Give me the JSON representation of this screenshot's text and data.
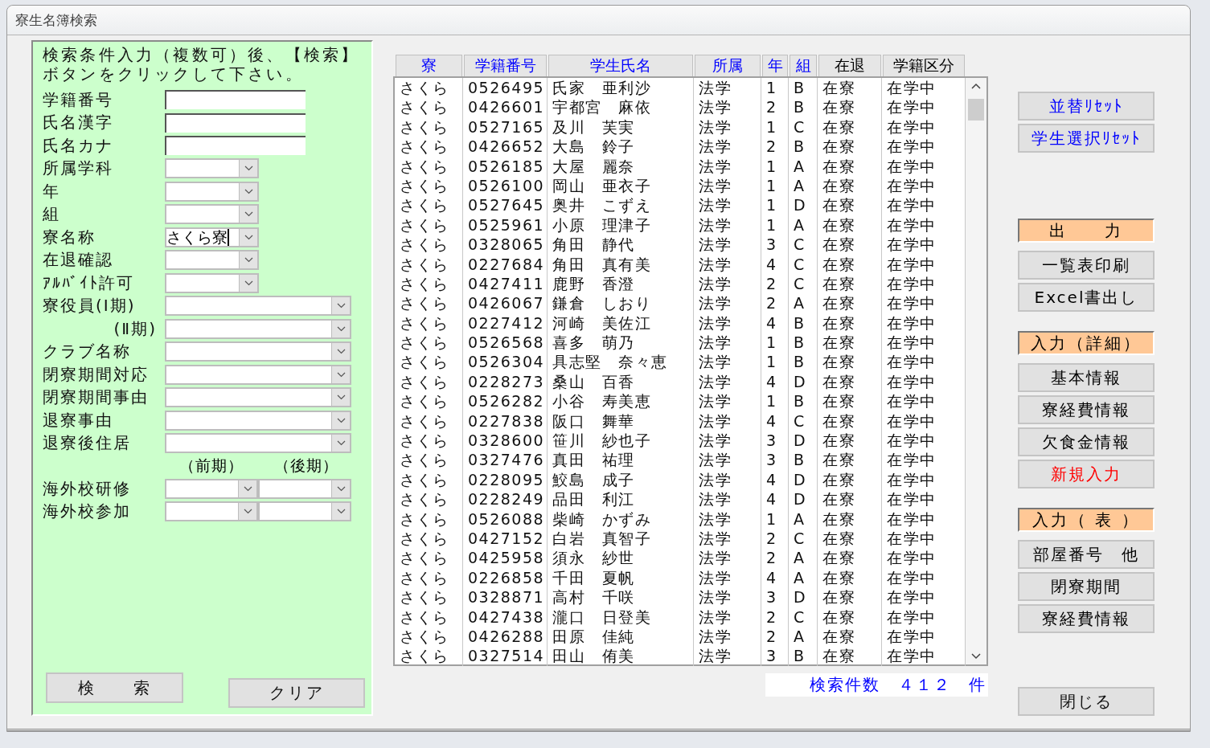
{
  "window": {
    "title": "寮生名簿検索"
  },
  "search_panel": {
    "instruction": "検索条件入力（複数可）後、【検索】ボタンをクリックして下さい。",
    "fields": [
      {
        "kind": "text",
        "label": "学籍番号"
      },
      {
        "kind": "text",
        "label": "氏名漢字"
      },
      {
        "kind": "text",
        "label": "氏名カナ"
      },
      {
        "kind": "select-short",
        "label": "所属学科"
      },
      {
        "kind": "select-short",
        "label": "年"
      },
      {
        "kind": "select-short",
        "label": "組"
      },
      {
        "kind": "select-short",
        "label": "寮名称",
        "value": "さくら寮"
      },
      {
        "kind": "select-short",
        "label": "在退確認"
      },
      {
        "kind": "select-short",
        "label": "ｱﾙﾊﾞｲﾄ許可"
      },
      {
        "kind": "select-long",
        "label": "寮役員(Ⅰ期)"
      },
      {
        "kind": "select-long",
        "label": "(Ⅱ期)",
        "indent": true
      },
      {
        "kind": "select-long",
        "label": "クラブ名称"
      },
      {
        "kind": "select-long",
        "label": "閉寮期間対応"
      },
      {
        "kind": "select-long",
        "label": "閉寮期間事由"
      },
      {
        "kind": "select-long",
        "label": "退寮事由"
      },
      {
        "kind": "select-long",
        "label": "退寮後住居"
      },
      {
        "kind": "captions",
        "captions": [
          "（前期）",
          "（後期）"
        ]
      },
      {
        "kind": "select-pair",
        "label": "海外校研修"
      },
      {
        "kind": "select-pair",
        "label": "海外校参加"
      }
    ],
    "buttons": [
      "検　　索",
      "クリア"
    ]
  },
  "table": {
    "columns": [
      {
        "label": "寮",
        "sortable": true
      },
      {
        "label": "学籍番号",
        "sortable": true
      },
      {
        "label": "学生氏名",
        "sortable": true
      },
      {
        "label": "所属",
        "sortable": true
      },
      {
        "label": "年",
        "sortable": true
      },
      {
        "label": "組",
        "sortable": true
      },
      {
        "label": "在退",
        "sortable": false
      },
      {
        "label": "学籍区分",
        "sortable": false
      }
    ],
    "rows": [
      [
        "さくら",
        "0526495",
        "氏家　亜利沙",
        "法学",
        "1",
        "B",
        "在寮",
        "在学中"
      ],
      [
        "さくら",
        "0426601",
        "宇都宮　麻依",
        "法学",
        "2",
        "B",
        "在寮",
        "在学中"
      ],
      [
        "さくら",
        "0527165",
        "及川　芙実",
        "法学",
        "1",
        "C",
        "在寮",
        "在学中"
      ],
      [
        "さくら",
        "0426652",
        "大島　鈴子",
        "法学",
        "2",
        "B",
        "在寮",
        "在学中"
      ],
      [
        "さくら",
        "0526185",
        "大屋　麗奈",
        "法学",
        "1",
        "A",
        "在寮",
        "在学中"
      ],
      [
        "さくら",
        "0526100",
        "岡山　亜衣子",
        "法学",
        "1",
        "A",
        "在寮",
        "在学中"
      ],
      [
        "さくら",
        "0527645",
        "奥井　こずえ",
        "法学",
        "1",
        "D",
        "在寮",
        "在学中"
      ],
      [
        "さくら",
        "0525961",
        "小原　理津子",
        "法学",
        "1",
        "A",
        "在寮",
        "在学中"
      ],
      [
        "さくら",
        "0328065",
        "角田　静代",
        "法学",
        "3",
        "C",
        "在寮",
        "在学中"
      ],
      [
        "さくら",
        "0227684",
        "角田　真有美",
        "法学",
        "4",
        "C",
        "在寮",
        "在学中"
      ],
      [
        "さくら",
        "0427411",
        "鹿野　香澄",
        "法学",
        "2",
        "C",
        "在寮",
        "在学中"
      ],
      [
        "さくら",
        "0426067",
        "鎌倉　しおり",
        "法学",
        "2",
        "A",
        "在寮",
        "在学中"
      ],
      [
        "さくら",
        "0227412",
        "河崎　美佐江",
        "法学",
        "4",
        "B",
        "在寮",
        "在学中"
      ],
      [
        "さくら",
        "0526568",
        "喜多　萌乃",
        "法学",
        "1",
        "B",
        "在寮",
        "在学中"
      ],
      [
        "さくら",
        "0526304",
        "具志堅　奈々恵",
        "法学",
        "1",
        "B",
        "在寮",
        "在学中"
      ],
      [
        "さくら",
        "0228273",
        "桑山　百香",
        "法学",
        "4",
        "D",
        "在寮",
        "在学中"
      ],
      [
        "さくら",
        "0526282",
        "小谷　寿美恵",
        "法学",
        "1",
        "B",
        "在寮",
        "在学中"
      ],
      [
        "さくら",
        "0227838",
        "阪口　舞華",
        "法学",
        "4",
        "C",
        "在寮",
        "在学中"
      ],
      [
        "さくら",
        "0328600",
        "笹川　紗也子",
        "法学",
        "3",
        "D",
        "在寮",
        "在学中"
      ],
      [
        "さくら",
        "0327476",
        "真田　祐理",
        "法学",
        "3",
        "B",
        "在寮",
        "在学中"
      ],
      [
        "さくら",
        "0228095",
        "鮫島　成子",
        "法学",
        "4",
        "D",
        "在寮",
        "在学中"
      ],
      [
        "さくら",
        "0228249",
        "品田　利江",
        "法学",
        "4",
        "D",
        "在寮",
        "在学中"
      ],
      [
        "さくら",
        "0526088",
        "柴崎　かずみ",
        "法学",
        "1",
        "A",
        "在寮",
        "在学中"
      ],
      [
        "さくら",
        "0427152",
        "白岩　真智子",
        "法学",
        "2",
        "C",
        "在寮",
        "在学中"
      ],
      [
        "さくら",
        "0425958",
        "須永　紗世",
        "法学",
        "2",
        "A",
        "在寮",
        "在学中"
      ],
      [
        "さくら",
        "0226858",
        "千田　夏帆",
        "法学",
        "4",
        "A",
        "在寮",
        "在学中"
      ],
      [
        "さくら",
        "0328871",
        "高村　千咲",
        "法学",
        "3",
        "D",
        "在寮",
        "在学中"
      ],
      [
        "さくら",
        "0427438",
        "瀧口　日登美",
        "法学",
        "2",
        "C",
        "在寮",
        "在学中"
      ],
      [
        "さくら",
        "0426288",
        "田原　佳純",
        "法学",
        "2",
        "A",
        "在寮",
        "在学中"
      ],
      [
        "さくら",
        "0327514",
        "田山　侑美",
        "法学",
        "3",
        "B",
        "在寮",
        "在学中"
      ]
    ],
    "result_count": "検索件数　４１２　件"
  },
  "side_panel": {
    "groups": [
      {
        "buttons": [
          {
            "label": "並替ﾘｾｯﾄ",
            "color": "#0000ff"
          },
          {
            "label": "学生選択ﾘｾｯﾄ",
            "color": "#0000ff"
          }
        ]
      },
      {
        "header": "出　　力",
        "buttons": [
          {
            "label": "一覧表印刷",
            "color": "#000000"
          },
          {
            "label": "Excel書出し",
            "color": "#000000"
          }
        ]
      },
      {
        "header": "入力（詳細）",
        "buttons": [
          {
            "label": "基本情報",
            "color": "#000000"
          },
          {
            "label": "寮経費情報",
            "color": "#000000"
          },
          {
            "label": "欠食金情報",
            "color": "#000000"
          },
          {
            "label": "新規入力",
            "color": "#ff0000"
          }
        ]
      },
      {
        "header": "入力（ 表 ）",
        "buttons": [
          {
            "label": "部屋番号　他",
            "color": "#000000"
          },
          {
            "label": "閉寮期間",
            "color": "#000000"
          },
          {
            "label": "寮経費情報",
            "color": "#000000"
          }
        ]
      }
    ],
    "close_button": "閉じる"
  }
}
